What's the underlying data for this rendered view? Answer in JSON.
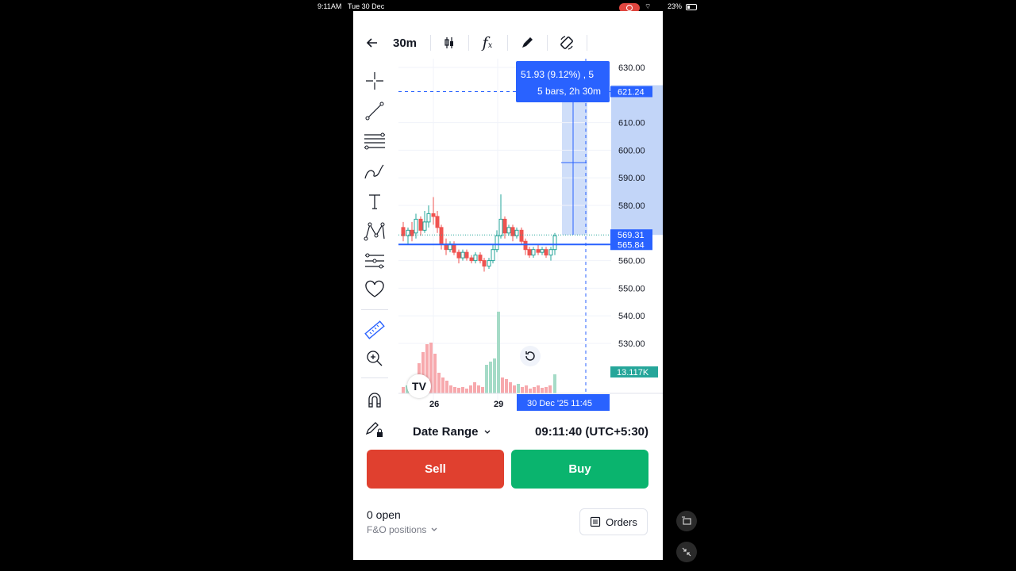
{
  "status_bar": {
    "time": "9:11AM",
    "date": "Tue 30 Dec",
    "battery": "23%"
  },
  "toolbar": {
    "interval": "30m"
  },
  "chart_data": {
    "type": "candlestick",
    "y_ticks": [
      "630.00",
      "610.00",
      "600.00",
      "590.00",
      "580.00",
      "560.00",
      "550.00",
      "540.00",
      "530.00"
    ],
    "y_tick_values": [
      630,
      610,
      600,
      590,
      580,
      560,
      550,
      540,
      530
    ],
    "x_ticks": [
      "26",
      "29"
    ],
    "price_badges": [
      {
        "label": "621.24",
        "value": 621.24,
        "color": "#2962ff"
      },
      {
        "label": "569.31",
        "value": 569.31,
        "color": "#2962ff"
      },
      {
        "label": "565.84",
        "value": 565.84,
        "color": "#2962ff"
      }
    ],
    "volume_badge": {
      "label": "13.117K",
      "color": "#26a69a"
    },
    "measure_tooltip": {
      "line1": "51.93 (9.12%) , 5",
      "line2": "5 bars, 2h 30m"
    },
    "cursor_time": "30 Dec '25   11:45",
    "horizontal_line": 565.84,
    "colors": {
      "up": "#26a69a",
      "down": "#ef5350",
      "accent": "#2962ff",
      "measure": "#bbd0f7"
    }
  },
  "footer": {
    "date_range": "Date Range",
    "clock": "09:11:40 (UTC+5:30)"
  },
  "actions": {
    "sell": "Sell",
    "buy": "Buy"
  },
  "positions": {
    "open": "0 open",
    "fo": "F&O positions",
    "orders": "Orders"
  }
}
